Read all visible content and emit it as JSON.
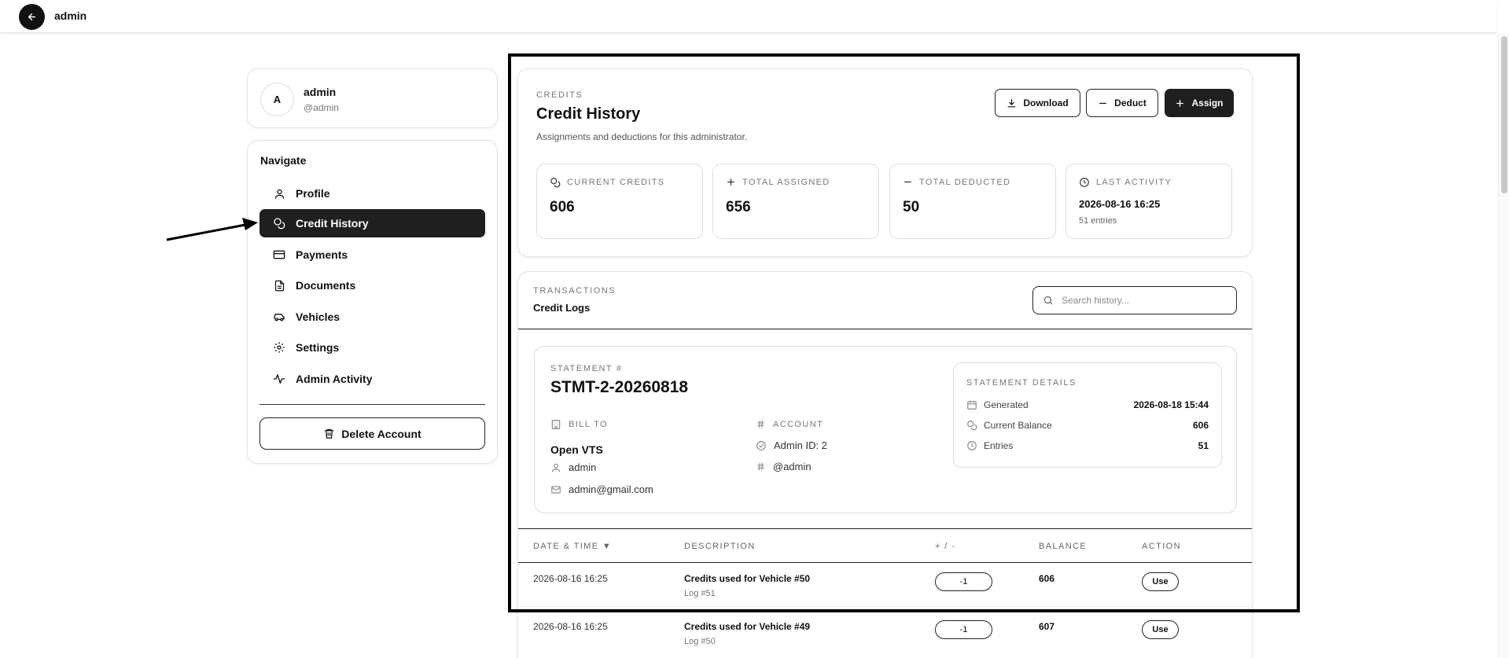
{
  "topbar": {
    "title": "admin"
  },
  "user": {
    "initial": "A",
    "name": "admin",
    "handle": "@admin"
  },
  "nav": {
    "heading": "Navigate",
    "items": [
      {
        "label": "Profile",
        "icon": "user-icon"
      },
      {
        "label": "Credit History",
        "icon": "coins-icon",
        "active": true
      },
      {
        "label": "Payments",
        "icon": "credit-card-icon"
      },
      {
        "label": "Documents",
        "icon": "document-icon"
      },
      {
        "label": "Vehicles",
        "icon": "car-icon"
      },
      {
        "label": "Settings",
        "icon": "gear-icon"
      },
      {
        "label": "Admin Activity",
        "icon": "activity-icon"
      }
    ],
    "delete_label": "Delete Account"
  },
  "header": {
    "eyebrow": "CREDITS",
    "title": "Credit History",
    "subtitle": "Assignments and deductions for this administrator.",
    "buttons": {
      "download": "Download",
      "deduct": "Deduct",
      "assign": "Assign"
    }
  },
  "stats": [
    {
      "label": "CURRENT CREDITS",
      "value": "606",
      "icon": "coins-icon"
    },
    {
      "label": "TOTAL ASSIGNED",
      "value": "656",
      "icon": "plus-icon"
    },
    {
      "label": "TOTAL DEDUCTED",
      "value": "50",
      "icon": "minus-icon"
    },
    {
      "label": "LAST ACTIVITY",
      "value": "2026-08-16 16:25",
      "sub": "51 entries",
      "icon": "clock-icon"
    }
  ],
  "transactions": {
    "eyebrow": "TRANSACTIONS",
    "title": "Credit Logs",
    "search_placeholder": "Search history..."
  },
  "statement": {
    "eyebrow": "STATEMENT #",
    "number": "STMT-2-20260818",
    "bill_to_label": "BILL TO",
    "bill_to_name": "Open VTS",
    "bill_to_user": "admin",
    "bill_to_email": "admin@gmail.com",
    "account_label": "ACCOUNT",
    "account_id": "Admin ID: 2",
    "account_handle": "@admin",
    "details": {
      "eyebrow": "STATEMENT DETAILS",
      "rows": [
        {
          "label": "Generated",
          "value": "2026-08-18 15:44"
        },
        {
          "label": "Current Balance",
          "value": "606"
        },
        {
          "label": "Entries",
          "value": "51"
        }
      ]
    }
  },
  "table": {
    "headers": [
      "DATE & TIME ▼",
      "DESCRIPTION",
      "+ / -",
      "BALANCE",
      "ACTION"
    ],
    "rows": [
      {
        "date": "2026-08-16 16:25",
        "desc": "Credits used for Vehicle #50",
        "log": "Log #51",
        "change": "-1",
        "balance": "606",
        "action": "Use"
      },
      {
        "date": "2026-08-16 16:25",
        "desc": "Credits used for Vehicle #49",
        "log": "Log #50",
        "change": "-1",
        "balance": "607",
        "action": "Use"
      }
    ]
  }
}
